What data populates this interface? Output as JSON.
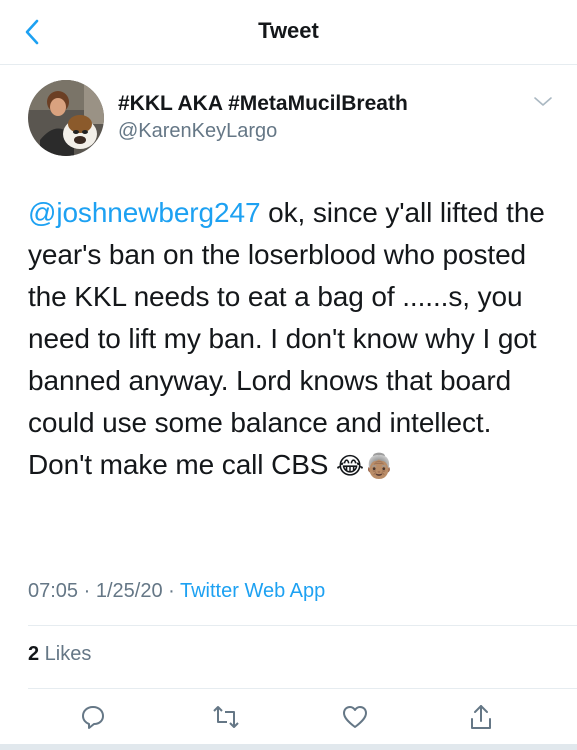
{
  "nav": {
    "title": "Tweet"
  },
  "user": {
    "display_name": "#KKL AKA #MetaMucilBreath",
    "handle": "@KarenKeyLargo"
  },
  "tweet": {
    "mention": "@joshnewberg247",
    "text": " ok, since y'all lifted the year's ban on the loserblood who posted the KKL needs to eat a bag of ......s, you need to lift my ban.  I don't know why I got banned anyway.  Lord knows that board could use some balance and intellect.  Don't make me call CBS ",
    "emoji_1": "😂",
    "emoji_2": "👵🏽"
  },
  "meta": {
    "time": "07:05",
    "dot1": " · ",
    "date": "1/25/20",
    "dot2": " · ",
    "app": "Twitter Web App"
  },
  "likes": {
    "count": "2",
    "label": " Likes"
  },
  "icons": {
    "back": "chevron-left-icon",
    "more": "chevron-down-icon",
    "reply": "reply-icon",
    "retweet": "retweet-icon",
    "like": "heart-icon",
    "share": "share-icon"
  },
  "colors": {
    "accent": "#1da1f2",
    "secondary_text": "#657786",
    "primary_text": "#14171a"
  }
}
